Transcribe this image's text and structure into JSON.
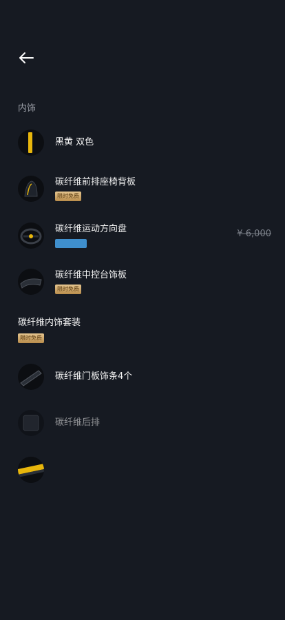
{
  "header": {
    "back_icon": "arrow-left-icon"
  },
  "section": {
    "title": "内饰"
  },
  "items": [
    {
      "name": "黑黄 双色",
      "thumb": "black-yellow-swatch"
    },
    {
      "name": "碳纤维前排座椅背板",
      "badge": "限时免费",
      "thumb": "seat-back-thumb"
    },
    {
      "name": "碳纤维运动方向盘",
      "price": "¥ 6,000",
      "thumb": "steering-wheel-thumb",
      "tag_color": "#3f8fcd"
    },
    {
      "name": "碳纤维中控台饰板",
      "badge": "限时免费",
      "thumb": "console-trim-thumb"
    }
  ],
  "pack": {
    "name": "碳纤维内饰套装",
    "badge": "限时免费"
  },
  "pack_items": [
    {
      "name": "碳纤维门板饰条4个",
      "thumb": "door-trim-thumb"
    },
    {
      "name": "碳纤维后排",
      "thumb": "rear-panel-thumb"
    },
    {
      "name": "",
      "thumb": "yellow-sill-thumb"
    }
  ],
  "colors": {
    "background": "#161a22",
    "accent_gold": "#e5c58f",
    "tag_blue": "#3f8fcd",
    "yellow": "#e8b60c"
  }
}
